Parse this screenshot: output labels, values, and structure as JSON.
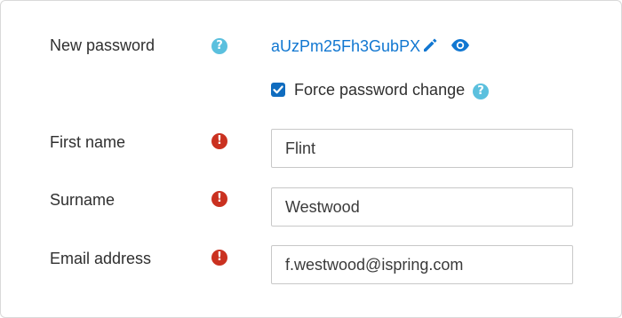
{
  "new_password": {
    "label": "New password",
    "help_icon": "question-circle-icon",
    "value": "aUzPm25Fh3GubPX",
    "edit_icon": "pencil-icon",
    "reveal_icon": "eye-icon"
  },
  "force_change": {
    "checked": true,
    "label": "Force password change",
    "help_icon": "question-circle-icon"
  },
  "first_name": {
    "label": "First name",
    "required_icon": "exclamation-circle-icon",
    "value": "Flint"
  },
  "surname": {
    "label": "Surname",
    "required_icon": "exclamation-circle-icon",
    "value": "Westwood"
  },
  "email": {
    "label": "Email address",
    "required_icon": "exclamation-circle-icon",
    "value": "f.westwood@ispring.com"
  },
  "colors": {
    "link": "#1177d1",
    "help": "#5bc0de",
    "required": "#ca3120",
    "checkbox": "#0f6cbf"
  }
}
